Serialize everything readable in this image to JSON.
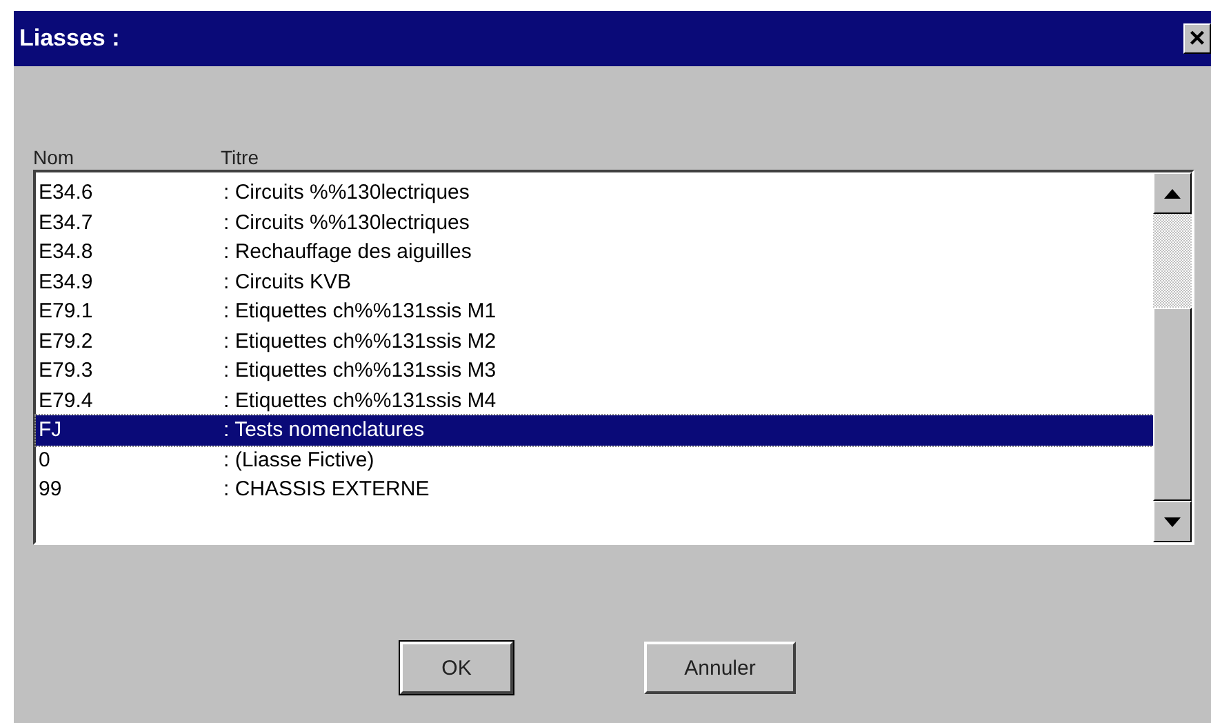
{
  "window": {
    "title": "Liasses :",
    "close": "×"
  },
  "list": {
    "columns": [
      "Nom",
      "Titre"
    ],
    "rows": [
      {
        "nom": "E34.6",
        "titre": ": Circuits %%130lectriques",
        "selected": false
      },
      {
        "nom": "E34.7",
        "titre": ": Circuits %%130lectriques",
        "selected": false
      },
      {
        "nom": "E34.8",
        "titre": ": Rechauffage des aiguilles",
        "selected": false
      },
      {
        "nom": "E34.9",
        "titre": ": Circuits KVB",
        "selected": false
      },
      {
        "nom": "E79.1",
        "titre": ": Etiquettes ch%%131ssis M1",
        "selected": false
      },
      {
        "nom": "E79.2",
        "titre": ": Etiquettes ch%%131ssis M2",
        "selected": false
      },
      {
        "nom": "E79.3",
        "titre": ": Etiquettes ch%%131ssis M3",
        "selected": false
      },
      {
        "nom": "E79.4",
        "titre": ": Etiquettes ch%%131ssis M4",
        "selected": false
      },
      {
        "nom": "FJ",
        "titre": ": Tests nomenclatures",
        "selected": true
      },
      {
        "nom": "0",
        "titre": ": (Liasse Fictive)",
        "selected": false
      },
      {
        "nom": "99",
        "titre": ": CHASSIS EXTERNE",
        "selected": false
      }
    ]
  },
  "buttons": [
    {
      "label": "OK",
      "default": true
    },
    {
      "label": "Annuler",
      "default": false
    }
  ]
}
